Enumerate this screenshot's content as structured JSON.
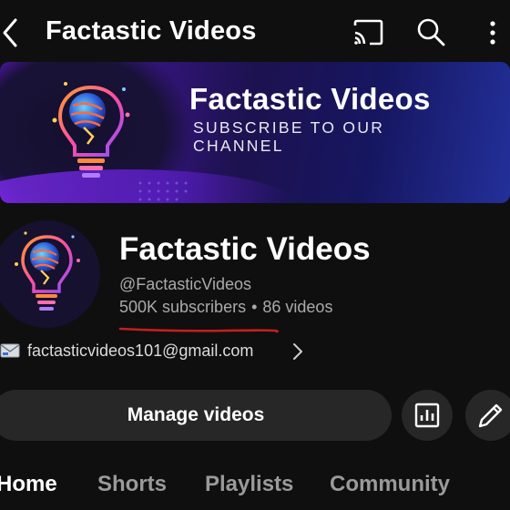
{
  "header": {
    "title": "Factastic Videos",
    "back_icon": "chevron-left-icon",
    "cast_icon": "cast-icon",
    "search_icon": "search-icon",
    "more_icon": "more-vertical-icon"
  },
  "banner": {
    "title": "Factastic Videos",
    "subtitle": "SUBSCRIBE TO OUR CHANNEL",
    "logo_icon": "lightbulb-icon"
  },
  "channel": {
    "name": "Factastic Videos",
    "handle": "@FactasticVideos",
    "subscribers": "500K subscribers",
    "separator": "•",
    "videos": "86 videos",
    "email": "factasticvideos101@gmail.com",
    "email_icon": "email-icon"
  },
  "actions": {
    "manage_label": "Manage videos",
    "analytics_icon": "analytics-icon",
    "edit_icon": "pencil-icon"
  },
  "tabs": [
    {
      "label": "Home",
      "active": true
    },
    {
      "label": "Shorts",
      "active": false
    },
    {
      "label": "Playlists",
      "active": false
    },
    {
      "label": "Community",
      "active": false
    }
  ],
  "colors": {
    "background": "#0f0f0f",
    "button_bg": "#272727",
    "secondary_text": "#aaaaaa",
    "annotation_underline": "#c81e1e"
  }
}
